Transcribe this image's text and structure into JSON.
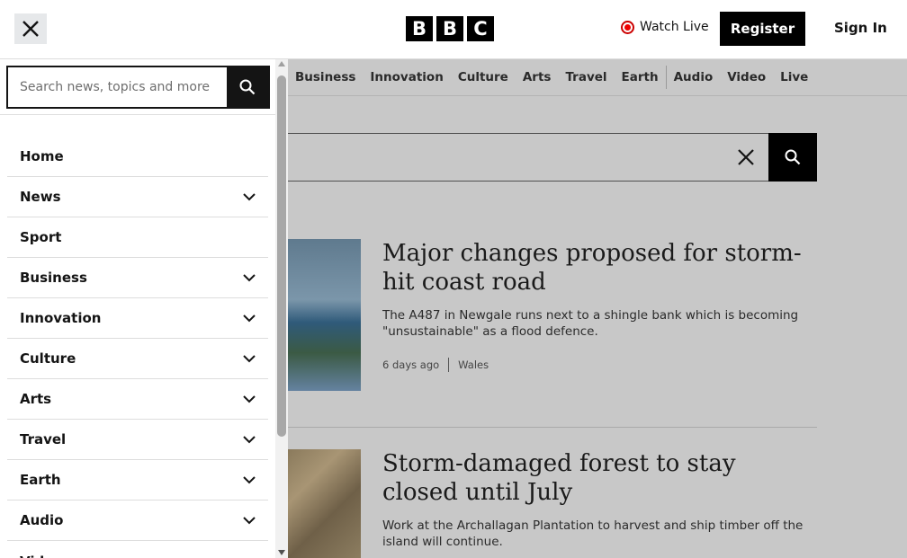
{
  "header": {
    "logo_letters": [
      "B",
      "B",
      "C"
    ],
    "watch_live": "Watch Live",
    "register": "Register",
    "sign_in": "Sign In",
    "close_icon": "close-icon",
    "live_dot_color": "#e00000"
  },
  "topnav": {
    "items": [
      "Business",
      "Innovation",
      "Culture",
      "Arts",
      "Travel",
      "Earth"
    ],
    "media_items": [
      "Audio",
      "Video",
      "Live"
    ]
  },
  "sidemenu": {
    "search_placeholder": "Search news, topics and more",
    "search_icon": "search-icon",
    "items": [
      {
        "label": "Home",
        "expandable": false
      },
      {
        "label": "News",
        "expandable": true
      },
      {
        "label": "Sport",
        "expandable": false
      },
      {
        "label": "Business",
        "expandable": true
      },
      {
        "label": "Innovation",
        "expandable": true
      },
      {
        "label": "Culture",
        "expandable": true
      },
      {
        "label": "Arts",
        "expandable": true
      },
      {
        "label": "Travel",
        "expandable": true
      },
      {
        "label": "Earth",
        "expandable": true
      },
      {
        "label": "Audio",
        "expandable": true
      },
      {
        "label": "Video",
        "expandable": false
      }
    ]
  },
  "articles": [
    {
      "title": "Major changes proposed for storm-hit coast road",
      "summary": "The A487 in Newgale runs next to a shingle bank which is becoming \"unsustainable\" as a flood defence.",
      "time": "6 days ago",
      "section": "Wales"
    },
    {
      "title": "Storm-damaged forest to stay closed until July",
      "summary": "Work at the Archallagan Plantation to harvest and ship timber off the island will continue."
    }
  ]
}
